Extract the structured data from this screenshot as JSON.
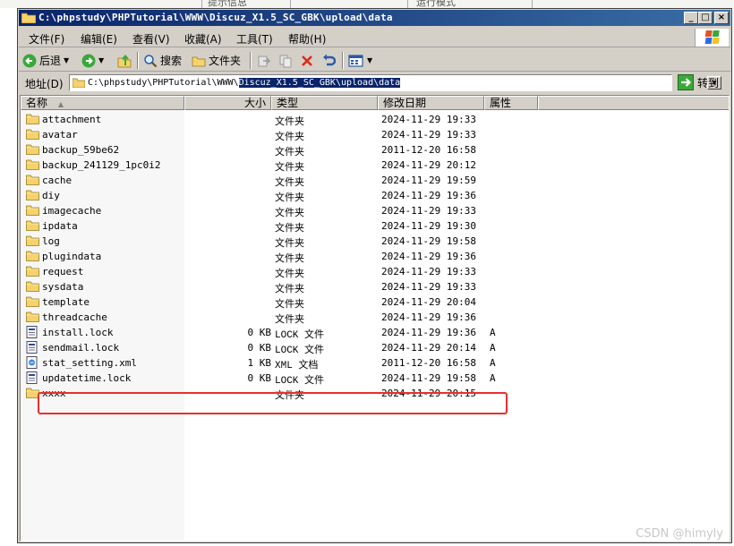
{
  "background_tabs": [
    "提示信息",
    "运行模式"
  ],
  "window": {
    "title": "C:\\phpstudy\\PHPTutorial\\WWW\\Discuz_X1.5_SC_GBK\\upload\\data"
  },
  "menu": {
    "items": [
      "文件(F)",
      "编辑(E)",
      "查看(V)",
      "收藏(A)",
      "工具(T)",
      "帮助(H)"
    ]
  },
  "toolbar": {
    "back_label": "后退",
    "search_label": "搜索",
    "folders_label": "文件夹"
  },
  "address": {
    "label": "地址(D)",
    "path_prefix": "C:\\phpstudy\\PHPTutorial\\WWW\\",
    "path_selected": "Discuz_X1.5_SC_GBK\\upload\\data",
    "go_label": "转到"
  },
  "columns": {
    "name": "名称",
    "size": "大小",
    "type": "类型",
    "modified": "修改日期",
    "attributes": "属性"
  },
  "files": [
    {
      "name": "attachment",
      "size": "",
      "type": "文件夹",
      "date": "2024-11-29 19:33",
      "attr": "",
      "icon": "folder"
    },
    {
      "name": "avatar",
      "size": "",
      "type": "文件夹",
      "date": "2024-11-29 19:33",
      "attr": "",
      "icon": "folder"
    },
    {
      "name": "backup_59be62",
      "size": "",
      "type": "文件夹",
      "date": "2011-12-20 16:58",
      "attr": "",
      "icon": "folder"
    },
    {
      "name": "backup_241129_1pc0i2",
      "size": "",
      "type": "文件夹",
      "date": "2024-11-29 20:12",
      "attr": "",
      "icon": "folder"
    },
    {
      "name": "cache",
      "size": "",
      "type": "文件夹",
      "date": "2024-11-29 19:59",
      "attr": "",
      "icon": "folder"
    },
    {
      "name": "diy",
      "size": "",
      "type": "文件夹",
      "date": "2024-11-29 19:36",
      "attr": "",
      "icon": "folder"
    },
    {
      "name": "imagecache",
      "size": "",
      "type": "文件夹",
      "date": "2024-11-29 19:33",
      "attr": "",
      "icon": "folder"
    },
    {
      "name": "ipdata",
      "size": "",
      "type": "文件夹",
      "date": "2024-11-29 19:30",
      "attr": "",
      "icon": "folder"
    },
    {
      "name": "log",
      "size": "",
      "type": "文件夹",
      "date": "2024-11-29 19:58",
      "attr": "",
      "icon": "folder"
    },
    {
      "name": "plugindata",
      "size": "",
      "type": "文件夹",
      "date": "2024-11-29 19:36",
      "attr": "",
      "icon": "folder"
    },
    {
      "name": "request",
      "size": "",
      "type": "文件夹",
      "date": "2024-11-29 19:33",
      "attr": "",
      "icon": "folder"
    },
    {
      "name": "sysdata",
      "size": "",
      "type": "文件夹",
      "date": "2024-11-29 19:33",
      "attr": "",
      "icon": "folder"
    },
    {
      "name": "template",
      "size": "",
      "type": "文件夹",
      "date": "2024-11-29 20:04",
      "attr": "",
      "icon": "folder"
    },
    {
      "name": "threadcache",
      "size": "",
      "type": "文件夹",
      "date": "2024-11-29 19:36",
      "attr": "",
      "icon": "folder"
    },
    {
      "name": "install.lock",
      "size": "0 KB",
      "type": "LOCK 文件",
      "date": "2024-11-29 19:36",
      "attr": "A",
      "icon": "file"
    },
    {
      "name": "sendmail.lock",
      "size": "0 KB",
      "type": "LOCK 文件",
      "date": "2024-11-29 20:14",
      "attr": "A",
      "icon": "file"
    },
    {
      "name": "stat_setting.xml",
      "size": "1 KB",
      "type": "XML 文档",
      "date": "2011-12-20 16:58",
      "attr": "A",
      "icon": "xml"
    },
    {
      "name": "updatetime.lock",
      "size": "0 KB",
      "type": "LOCK 文件",
      "date": "2024-11-29 19:58",
      "attr": "A",
      "icon": "file"
    },
    {
      "name": "xxxx",
      "size": "",
      "type": "文件夹",
      "date": "2024-11-29 20:15",
      "attr": "",
      "icon": "folder"
    }
  ],
  "watermark": "CSDN @himyly",
  "colors": {
    "title_start": "#0a246a",
    "title_end": "#3a6ea5",
    "chrome": "#d4d0c8",
    "highlight_box": "#e8302a",
    "folder": "#f5d26b"
  }
}
